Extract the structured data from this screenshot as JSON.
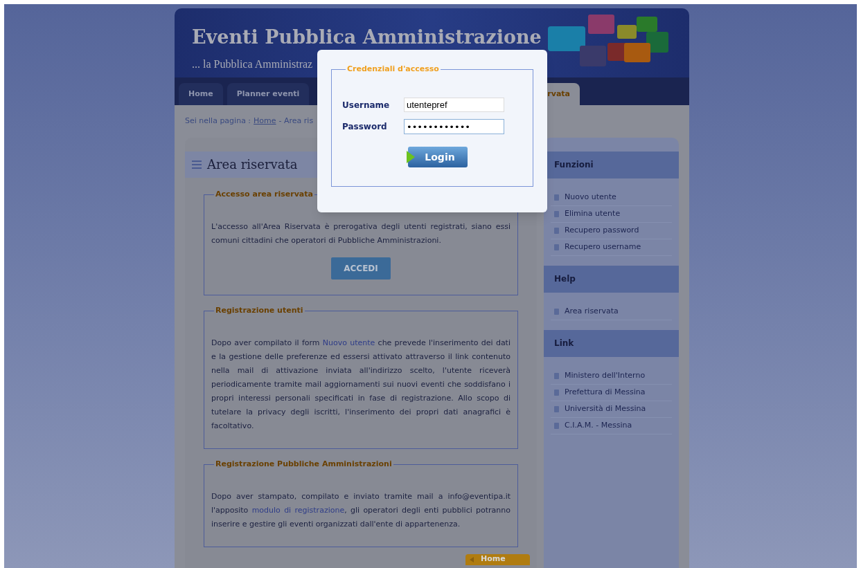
{
  "header": {
    "title": "Eventi Pubblica Amministrazione",
    "subtitle": "... la Pubblica Amministraz"
  },
  "nav": {
    "tabs": [
      {
        "label": "Home",
        "selected": false
      },
      {
        "label": "Planner eventi",
        "selected": false
      },
      {
        "label": "rvata",
        "selected": true
      }
    ]
  },
  "breadcrumb": {
    "prefix": "Sei nella pagina :",
    "link": "Home",
    "rest": "- Area ris"
  },
  "main": {
    "title": "Area riservata",
    "sections": [
      {
        "legend": "Accesso area riservata",
        "text": "L'accesso all'Area Riservata è prerogativa degli utenti registrati, siano essi comuni cittadini che operatori di Pubbliche Amministrazioni.",
        "button": "ACCEDI"
      },
      {
        "legend": "Registrazione utenti",
        "text_before": "Dopo aver compilato il form ",
        "link": "Nuovo utente",
        "text_after": " che prevede l'inserimento dei dati e la gestione delle preferenze ed essersi attivato attraverso il link contenuto nella mail di attivazione inviata all'indirizzo scelto, l'utente riceverà periodicamente tramite mail aggiornamenti sui nuovi eventi che soddisfano i propri interessi personali specificati in fase di registrazione. Allo scopo di tutelare la privacy degli iscritti, l'inserimento dei propri dati anagrafici è facoltativo."
      },
      {
        "legend": "Registrazione Pubbliche Amministrazioni",
        "text_before": "Dopo aver stampato, compilato e inviato tramite mail a info@eventipa.it l'apposito ",
        "link": "modulo di registrazione",
        "text_after": ", gli operatori degli enti pubblici potranno inserire e gestire gli eventi organizzati dall'ente di appartenenza."
      }
    ],
    "home_button": "Home"
  },
  "sidebar": {
    "groups": [
      {
        "title": "Funzioni",
        "items": [
          "Nuovo utente",
          "Elimina utente",
          "Recupero password",
          "Recupero username"
        ]
      },
      {
        "title": "Help",
        "items": [
          "Area riservata"
        ]
      },
      {
        "title": "Link",
        "items": [
          "Ministero dell'Interno",
          "Prefettura di Messina",
          "Università di Messina",
          "C.I.A.M. - Messina"
        ]
      }
    ]
  },
  "login_dialog": {
    "legend": "Credenziali d'accesso",
    "username_label": "Username",
    "username_value": "utentepref",
    "password_label": "Password",
    "password_value": "••••••••••••",
    "button": "Login"
  }
}
